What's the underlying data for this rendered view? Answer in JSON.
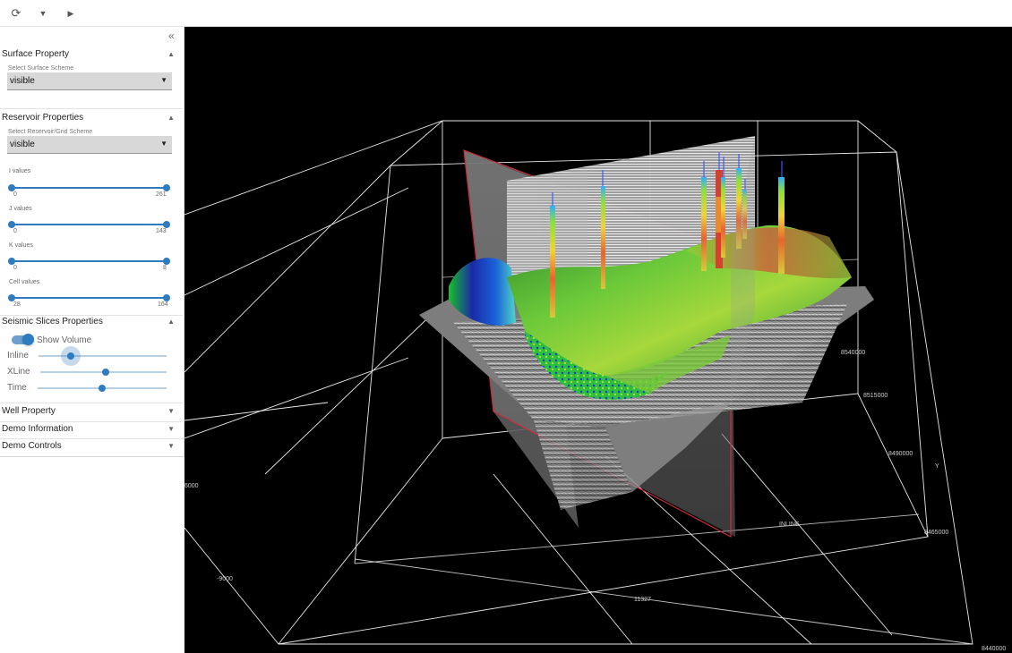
{
  "toolbar": {
    "refresh_icon": "refresh-icon",
    "dropdown_icon": "caret-down-icon",
    "play_icon": "play-icon"
  },
  "panel": {
    "collapse_icon": "double-chevron-left-icon",
    "surface": {
      "title": "Surface Property",
      "scheme_label": "Select Surface Scheme",
      "scheme_value": "visible"
    },
    "reservoir": {
      "title": "Reservoir Properties",
      "scheme_label": "Select Reservoir/Grid Scheme",
      "scheme_value": "visible",
      "ranges": [
        {
          "label": "I values",
          "min": "0",
          "max": "261"
        },
        {
          "label": "J values",
          "min": "0",
          "max": "143"
        },
        {
          "label": "K values",
          "min": "0",
          "max": "8"
        },
        {
          "label": "Cell values",
          "min": "28",
          "max": "164"
        }
      ]
    },
    "seismic": {
      "title": "Seismic Slices Properties",
      "show_volume_label": "Show Volume",
      "show_volume": true,
      "sliders": [
        {
          "label": "Inline",
          "value": 0.25
        },
        {
          "label": "XLine",
          "value": 0.52
        },
        {
          "label": "Time",
          "value": 0.5
        }
      ]
    },
    "collapsed_sections": [
      "Well Property",
      "Demo Information",
      "Demo Controls"
    ]
  },
  "viewport": {
    "axis_labels": {
      "y_name": "Y",
      "y_ticks": [
        "8540000",
        "8515000",
        "8490000",
        "8465000",
        "8440000"
      ],
      "left_ticks": [
        "6000",
        "-9000"
      ],
      "inline": "INLINE",
      "xline_value": "11327",
      "inner_small": [
        "8540000"
      ]
    }
  }
}
